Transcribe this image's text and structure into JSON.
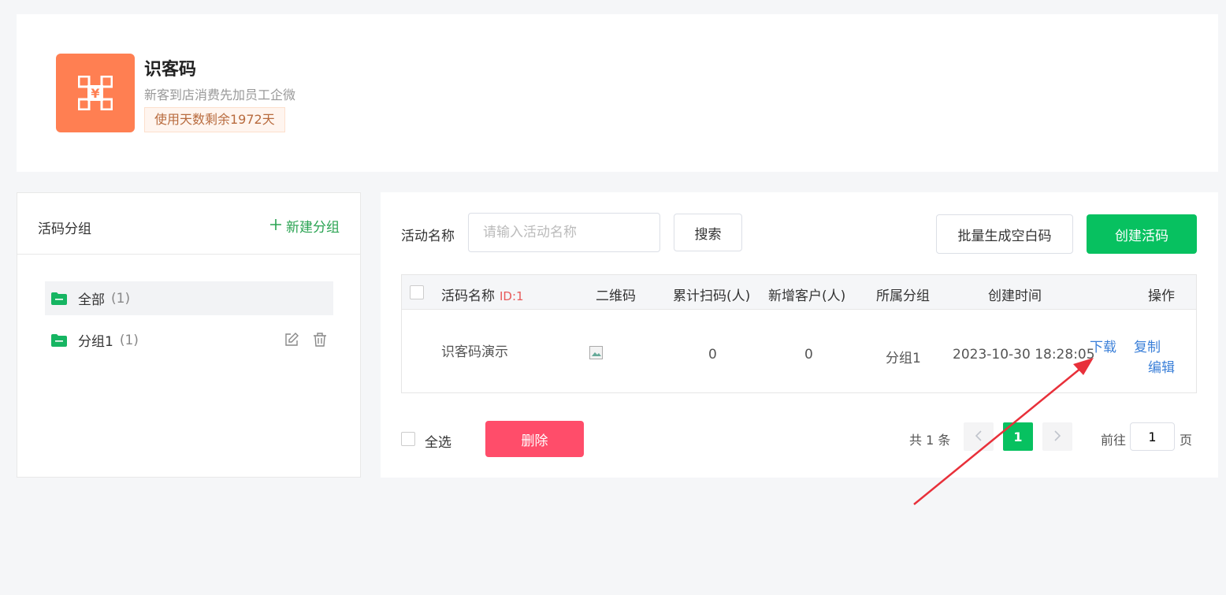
{
  "app": {
    "title": "识客码",
    "description": "新客到店消费先加员工企微",
    "badge": "使用天数剩余1972天",
    "icon": "qr-code-icon",
    "icon_color": "#ff7f52"
  },
  "group_panel": {
    "title": "活码分组",
    "new_group_label": "新建分组",
    "items": [
      {
        "label": "全部",
        "count": "(1)",
        "active": true
      },
      {
        "label": "分组1",
        "count": "(1)",
        "active": false
      }
    ]
  },
  "filter": {
    "label": "活动名称",
    "placeholder": "请输入活动名称",
    "search_label": "搜索",
    "batch_label": "批量生成空白码",
    "create_label": "创建活码"
  },
  "table": {
    "headers": {
      "name": "活码名称",
      "id_tag": "ID:1",
      "qr": "二维码",
      "scans": "累计扫码(人)",
      "new_customers": "新增客户(人)",
      "group": "所属分组",
      "created": "创建时间",
      "actions": "操作"
    },
    "rows": [
      {
        "name": "识客码演示",
        "scans": "0",
        "new_customers": "0",
        "group": "分组1",
        "created": "2023-10-30 18:28:05",
        "actions": {
          "download": "下载",
          "copy": "复制",
          "edit": "编辑"
        }
      }
    ]
  },
  "footer": {
    "select_all": "全选",
    "delete_label": "删除",
    "total": "共 1 条",
    "current_page": "1",
    "goto_prefix": "前往",
    "goto_value": "1",
    "goto_suffix": "页"
  },
  "colors": {
    "primary_green": "#07c160",
    "delete_red": "#ff4d6a",
    "link_blue": "#3a7fd8",
    "annotation_arrow": "#e8303a"
  }
}
